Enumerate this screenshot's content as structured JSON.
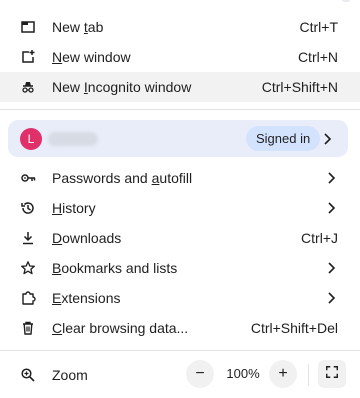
{
  "menu": {
    "items_top": [
      {
        "name": "new-tab",
        "label_pre": "New ",
        "label_ul": "t",
        "label_post": "ab",
        "shortcut": "Ctrl+T",
        "icon": "new-tab-icon"
      },
      {
        "name": "new-window",
        "label_pre": "",
        "label_ul": "N",
        "label_post": "ew window",
        "shortcut": "Ctrl+N",
        "icon": "new-window-icon"
      },
      {
        "name": "new-incognito-window",
        "label_pre": "New ",
        "label_ul": "I",
        "label_post": "ncognito window",
        "shortcut": "Ctrl+Shift+N",
        "icon": "incognito-icon"
      }
    ],
    "profile": {
      "avatar_letter": "L",
      "status": "Signed in"
    },
    "items_mid": [
      {
        "name": "passwords-and-autofill",
        "label_pre": "Passwords and ",
        "label_ul": "a",
        "label_post": "utofill",
        "shortcut": "",
        "icon": "key-icon",
        "submenu": true
      },
      {
        "name": "history",
        "label_pre": "",
        "label_ul": "H",
        "label_post": "istory",
        "shortcut": "",
        "icon": "history-icon",
        "submenu": true
      },
      {
        "name": "downloads",
        "label_pre": "",
        "label_ul": "D",
        "label_post": "ownloads",
        "shortcut": "Ctrl+J",
        "icon": "download-icon",
        "submenu": false
      },
      {
        "name": "bookmarks-and-lists",
        "label_pre": "",
        "label_ul": "B",
        "label_post": "ookmarks and lists",
        "shortcut": "",
        "icon": "star-icon",
        "submenu": true
      },
      {
        "name": "extensions",
        "label_pre": "",
        "label_ul": "E",
        "label_post": "xtensions",
        "shortcut": "",
        "icon": "puzzle-icon",
        "submenu": true
      },
      {
        "name": "clear-browsing-data",
        "label_pre": "",
        "label_ul": "C",
        "label_post": "lear browsing data...",
        "shortcut": "Ctrl+Shift+Del",
        "icon": "trash-icon",
        "submenu": false
      }
    ],
    "zoom": {
      "label": "Zoom",
      "minus": "−",
      "level": "100%",
      "plus": "+"
    }
  },
  "colors": {
    "avatar": "#e0306a",
    "profile_bg": "#e8edf9",
    "badge_bg": "#d3e3fd",
    "hover_bg": "#f2f2f3"
  }
}
